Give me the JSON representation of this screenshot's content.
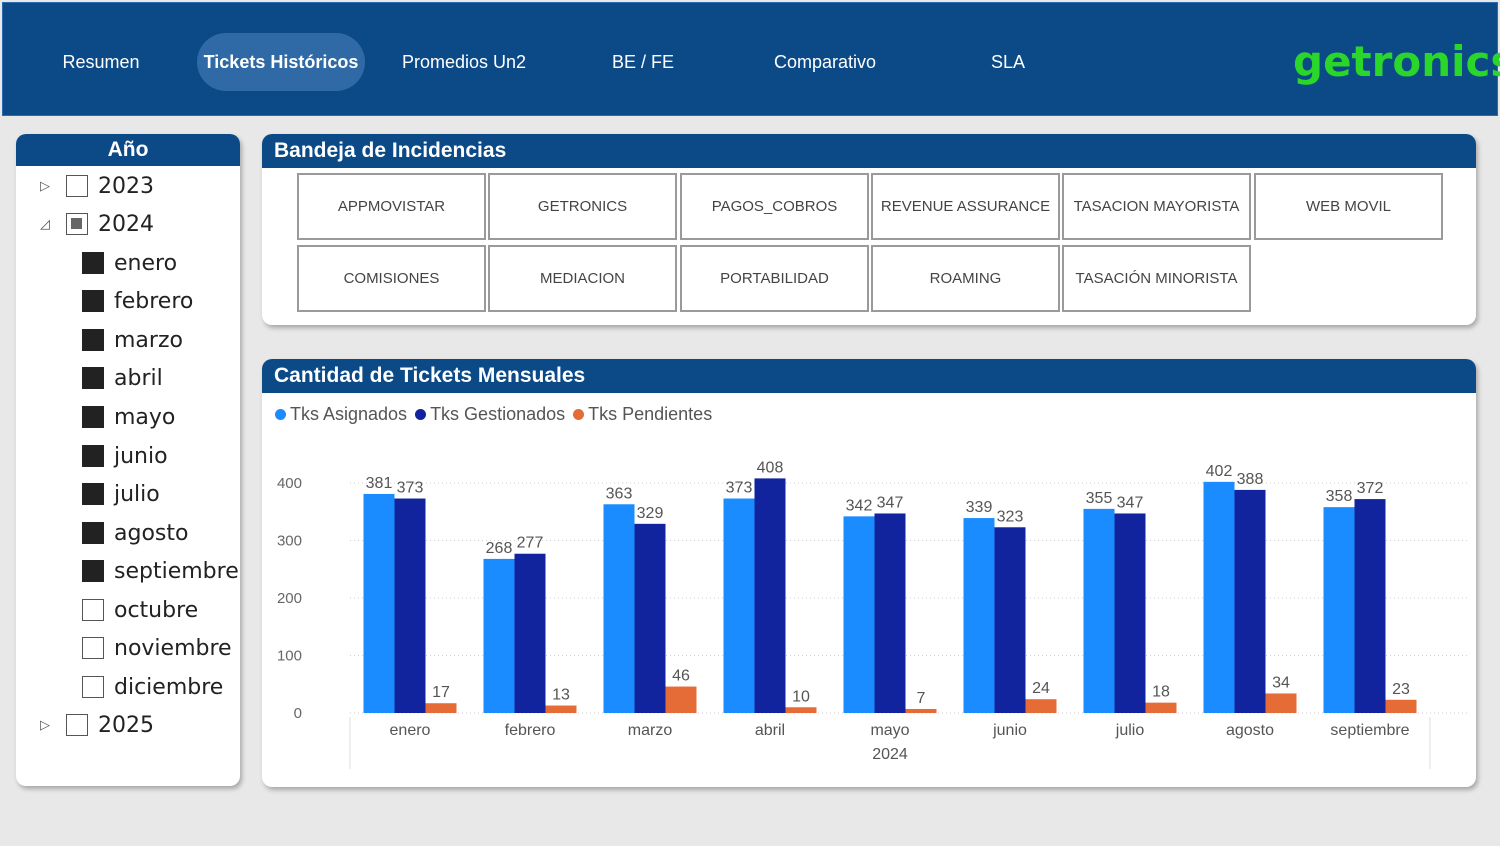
{
  "nav": {
    "items": [
      "Resumen",
      "Tickets Históricos",
      "Promedios Un2",
      "BE / FE",
      "Comparativo",
      "SLA"
    ],
    "active_index": 1
  },
  "logo": {
    "text": "getronics"
  },
  "slicer": {
    "title": "Año",
    "years": [
      {
        "label": "2023",
        "state": "unchecked",
        "expanded": false
      },
      {
        "label": "2024",
        "state": "partial",
        "expanded": true
      },
      {
        "label": "2025",
        "state": "unchecked",
        "expanded": false
      }
    ],
    "months": [
      {
        "label": "enero",
        "checked": true
      },
      {
        "label": "febrero",
        "checked": true
      },
      {
        "label": "marzo",
        "checked": true
      },
      {
        "label": "abril",
        "checked": true
      },
      {
        "label": "mayo",
        "checked": true
      },
      {
        "label": "junio",
        "checked": true
      },
      {
        "label": "julio",
        "checked": true
      },
      {
        "label": "agosto",
        "checked": true
      },
      {
        "label": "septiembre",
        "checked": true
      },
      {
        "label": "octubre",
        "checked": false
      },
      {
        "label": "noviembre",
        "checked": false
      },
      {
        "label": "diciembre",
        "checked": false
      }
    ]
  },
  "bandeja": {
    "title": "Bandeja de Incidencias",
    "tiles": [
      "APPMOVISTAR",
      "GETRONICS",
      "PAGOS_COBROS",
      "REVENUE ASSURANCE",
      "TASACION MAYORISTA",
      "WEB MOVIL",
      "COMISIONES",
      "MEDIACION",
      "PORTABILIDAD",
      "ROAMING",
      "TASACIÓN MINORISTA"
    ]
  },
  "chart_card": {
    "title": "Cantidad de Tickets Mensuales"
  },
  "colors": {
    "header": "#0b4a87",
    "logo": "#2bd62b",
    "asignados": "#1a8cff",
    "gestionados": "#12239e",
    "pendientes": "#e66c37"
  },
  "chart_data": {
    "type": "bar",
    "title": "Cantidad de Tickets Mensuales",
    "categories": [
      "enero",
      "febrero",
      "marzo",
      "abril",
      "mayo",
      "junio",
      "julio",
      "agosto",
      "septiembre"
    ],
    "x_group_label": "2024",
    "series": [
      {
        "name": "Tks Asignados",
        "color": "#1a8cff",
        "values": [
          381,
          268,
          363,
          373,
          342,
          339,
          355,
          402,
          358
        ]
      },
      {
        "name": "Tks Gestionados",
        "color": "#12239e",
        "values": [
          373,
          277,
          329,
          408,
          347,
          323,
          347,
          388,
          372
        ]
      },
      {
        "name": "Tks Pendientes",
        "color": "#e66c37",
        "values": [
          17,
          13,
          46,
          10,
          7,
          24,
          18,
          34,
          23
        ]
      }
    ],
    "y_ticks": [
      0,
      100,
      200,
      300,
      400
    ],
    "ylim": [
      0,
      440
    ],
    "grid": true,
    "legend": "top-left"
  }
}
